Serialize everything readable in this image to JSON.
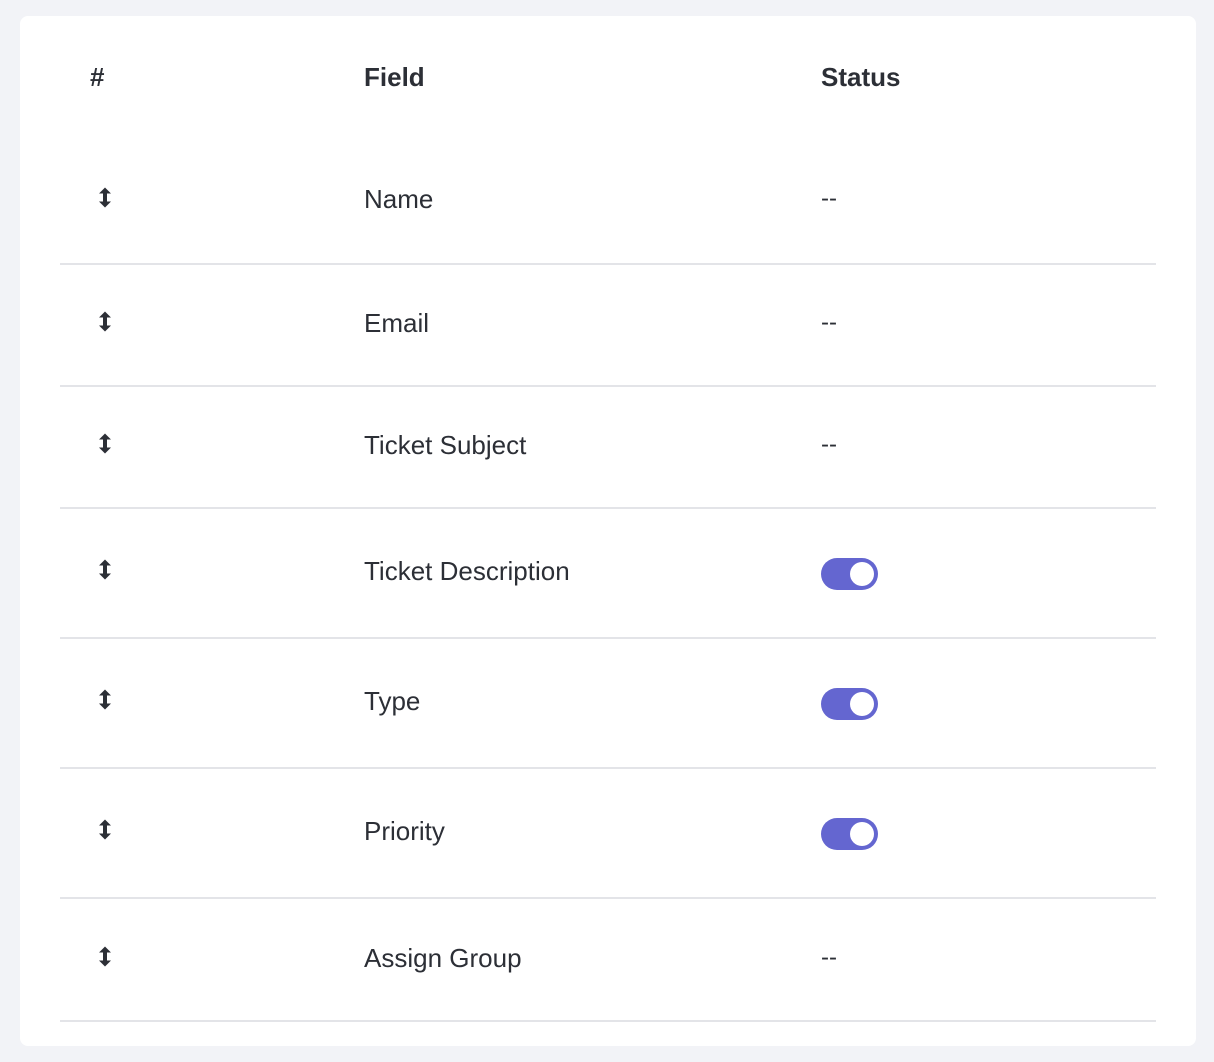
{
  "table": {
    "headers": {
      "hash": "#",
      "field": "Field",
      "status": "Status"
    },
    "rows": [
      {
        "field": "Name",
        "status_type": "text",
        "status_text": "--"
      },
      {
        "field": "Email",
        "status_type": "text",
        "status_text": "--"
      },
      {
        "field": "Ticket Subject",
        "status_type": "text",
        "status_text": "--"
      },
      {
        "field": "Ticket Description",
        "status_type": "toggle",
        "status_on": true
      },
      {
        "field": "Type",
        "status_type": "toggle",
        "status_on": true
      },
      {
        "field": "Priority",
        "status_type": "toggle",
        "status_on": true
      },
      {
        "field": "Assign Group",
        "status_type": "text",
        "status_text": "--"
      }
    ]
  },
  "icons": {
    "drag": "drag-handle-icon"
  },
  "colors": {
    "toggle_on": "#6466d0",
    "page_background": "#f2f3f7",
    "divider": "#e3e4e8"
  }
}
